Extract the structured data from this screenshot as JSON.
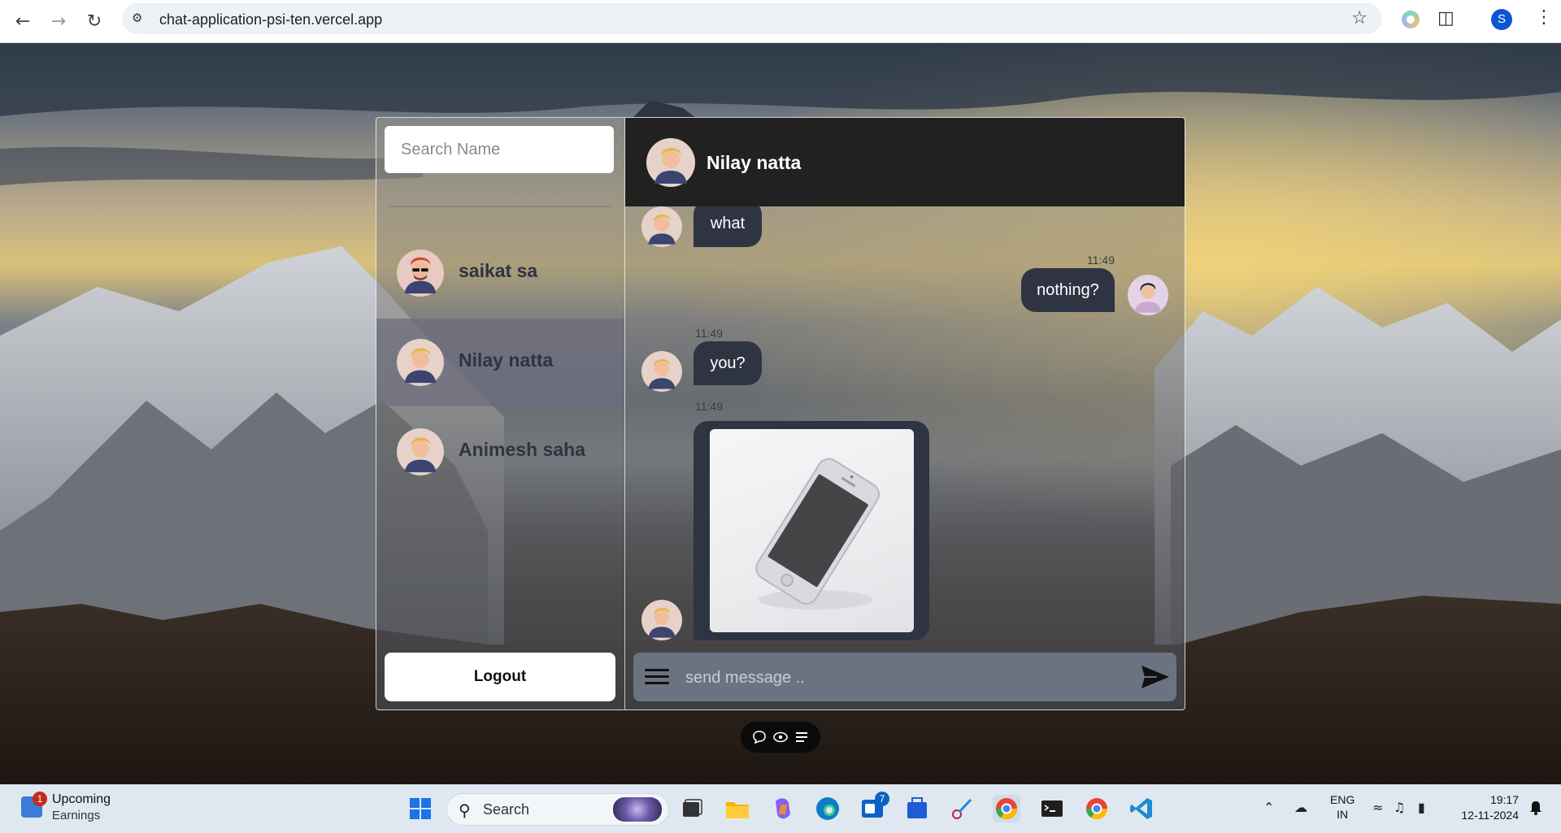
{
  "browser": {
    "url": "chat-application-psi-ten.vercel.app",
    "profile_initial": "S",
    "icons": [
      "back-icon",
      "forward-icon",
      "reload-icon",
      "site-settings-icon",
      "star-icon",
      "extensions-icon",
      "kebab-menu-icon"
    ]
  },
  "sidebar": {
    "search_placeholder": "Search Name",
    "contacts": [
      {
        "name": "saikat sa",
        "avatar": "avatar-sunglasses",
        "active": false
      },
      {
        "name": "Nilay natta",
        "avatar": "avatar-blond",
        "active": true
      },
      {
        "name": "Animesh saha",
        "avatar": "avatar-blond",
        "active": false
      }
    ],
    "logout_label": "Logout"
  },
  "chat": {
    "header_name": "Nilay natta",
    "messages": [
      {
        "direction": "in",
        "text": "what",
        "time": ""
      },
      {
        "direction": "out",
        "text": "nothing?",
        "time": "11:49"
      },
      {
        "direction": "in",
        "text": "you?",
        "time": "11:49"
      },
      {
        "direction": "in",
        "type": "image",
        "image": "smartphone-photo",
        "time": "11:49"
      }
    ],
    "composer_placeholder": "send message .."
  },
  "floating_toolbar": {
    "icons": [
      "chat-bubble-icon",
      "eye-icon",
      "list-icon"
    ]
  },
  "taskbar": {
    "widget_badge": "1",
    "widget_title": "Upcoming",
    "widget_subtitle": "Earnings",
    "search_label": "Search",
    "store_badge": "7",
    "lang_line1": "ENG",
    "lang_line2": "IN",
    "time": "19:17",
    "date": "12-11-2024"
  },
  "colors": {
    "bubble": "#2e3442",
    "chat_header": "#212121",
    "active_contact": "#6e6e7d",
    "composer": "#6b7380"
  }
}
